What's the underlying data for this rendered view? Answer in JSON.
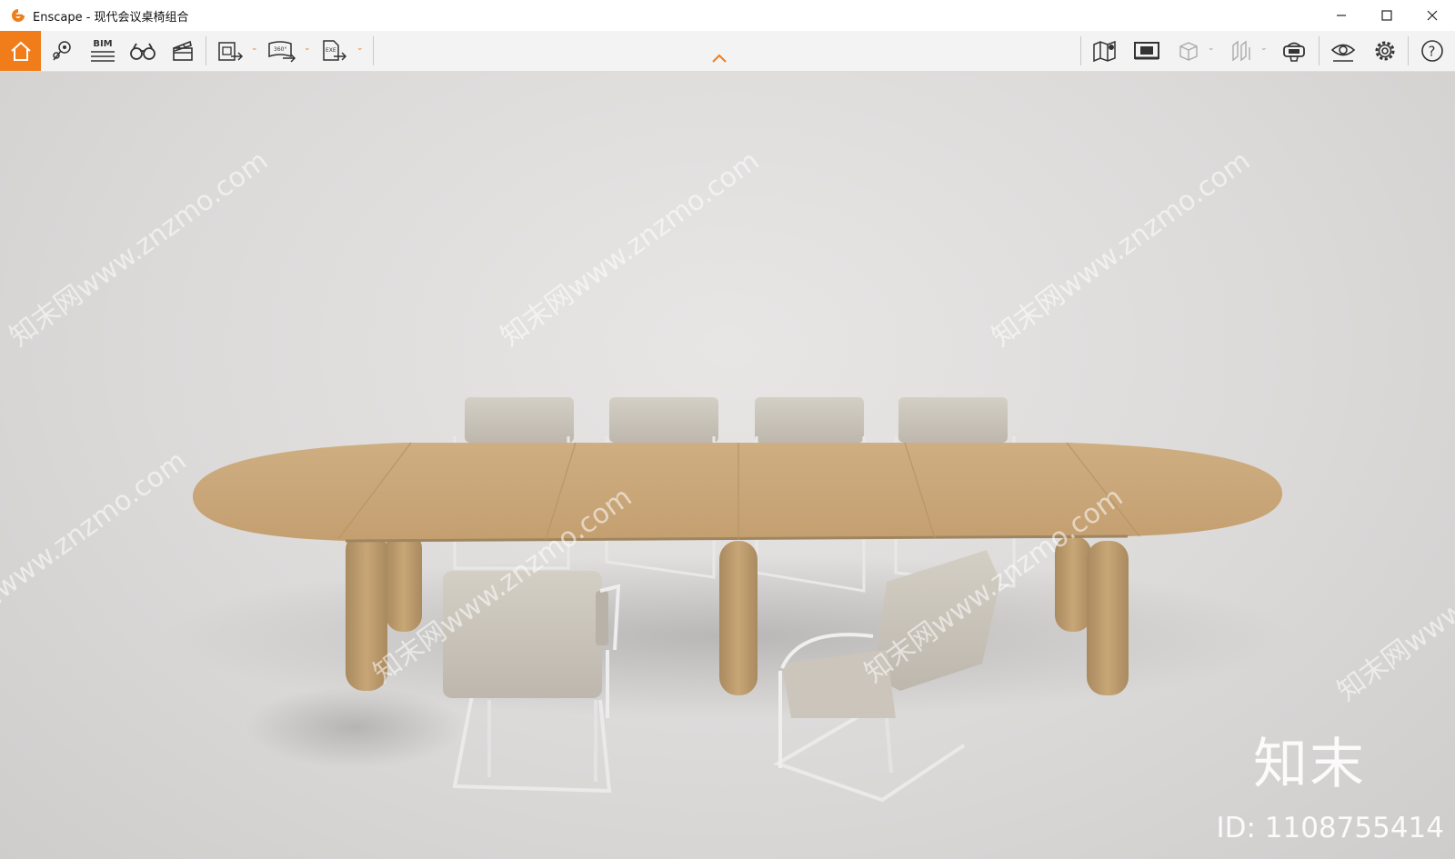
{
  "window": {
    "app_name": "Enscape",
    "title": "Enscape - 现代会议桌椅组合"
  },
  "toolbar": {
    "bim_label": "BIM",
    "pano_label": "360°",
    "exe_label": "EXE",
    "accent": "#f07d1a"
  },
  "viewport": {
    "watermark_text": "知末网www.znzmo.com",
    "brand": "知末",
    "id_label": "ID: 1108755414"
  },
  "icons": [
    "home-icon",
    "pin-icon",
    "bim-icon",
    "binoculars-icon",
    "clapperboard-icon",
    "export-screenshot-icon",
    "export-panorama-icon",
    "export-exe-icon",
    "map-icon",
    "monitor-icon",
    "cube-icon",
    "vr-icon",
    "headset-icon",
    "eye-icon",
    "gear-icon",
    "help-icon"
  ]
}
